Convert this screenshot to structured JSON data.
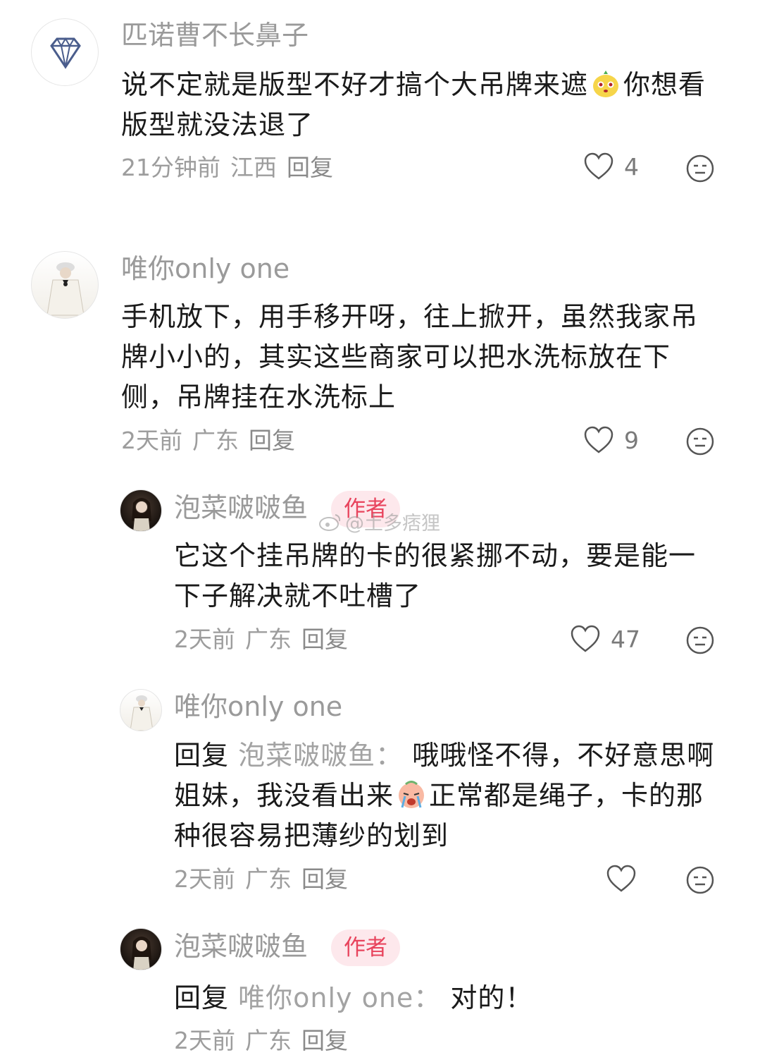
{
  "comments": [
    {
      "avatar": "diamond-avatar",
      "name": "匹诺曹不长鼻子",
      "text_before_emoji": "说不定就是版型不好才搞个大吊牌来遮",
      "emoji": "cute-face-emoji",
      "text_after_emoji": "你想看版型就没法退了",
      "time": "21分钟前",
      "location": "江西",
      "reply": "回复",
      "likes": "4"
    },
    {
      "avatar": "girl-avatar",
      "name": "唯你only one",
      "text": "手机放下，用手移开呀，往上掀开，虽然我家吊牌小小的，其实这些商家可以把水洗标放在下侧，吊牌挂在水洗标上",
      "time": "2天前",
      "location": "广东",
      "reply": "回复",
      "likes": "9"
    },
    {
      "avatar": "dark-avatar",
      "name": "泡菜啵啵鱼",
      "badge": "作者",
      "text": "它这个挂吊牌的卡的很紧挪不动，要是能一下子解决就不吐槽了",
      "time": "2天前",
      "location": "广东",
      "reply": "回复",
      "likes": "47"
    },
    {
      "avatar": "girl-avatar",
      "name": "唯你only one",
      "reply_prefix": "回复",
      "reply_target": "泡菜啵啵鱼：",
      "text_before_emoji": "哦哦怪不得，不好意思啊姐妹，我没看出来",
      "emoji": "crying-emoji",
      "text_after_emoji": "正常都是绳子，卡的那种很容易把薄纱的划到",
      "time": "2天前",
      "location": "广东",
      "reply": "回复",
      "likes": ""
    },
    {
      "avatar": "dark-avatar",
      "name": "泡菜啵啵鱼",
      "badge": "作者",
      "reply_prefix": "回复",
      "reply_target": "唯你only one：",
      "text": "对的！",
      "time": "2天前",
      "location": "广东",
      "reply": "回复"
    }
  ],
  "watermark": "@土多痞狸",
  "colors": {
    "badge_bg": "#fde8ec",
    "badge_text": "#e8445d",
    "meta": "#9d9d9d"
  }
}
